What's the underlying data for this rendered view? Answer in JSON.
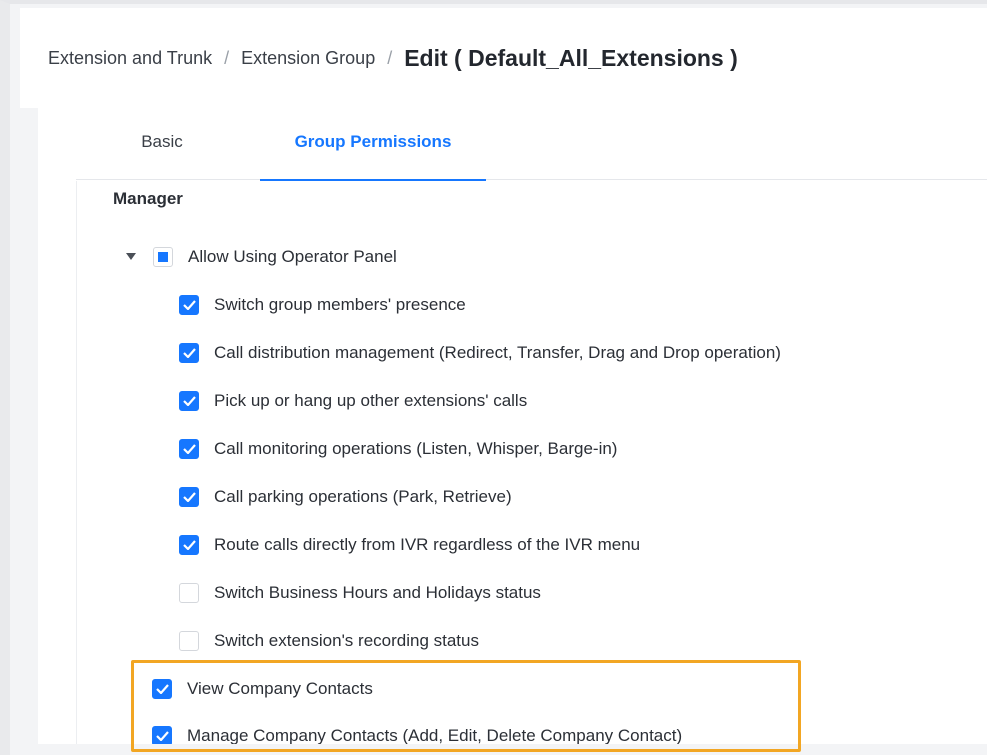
{
  "breadcrumb": {
    "items": [
      "Extension and Trunk",
      "Extension Group"
    ],
    "separator": "/",
    "current": "Edit ( Default_All_Extensions )"
  },
  "tabs": [
    {
      "label": "Basic",
      "active": false
    },
    {
      "label": "Group Permissions",
      "active": true
    }
  ],
  "section": {
    "title": "Manager"
  },
  "operator_panel": {
    "label": "Allow Using Operator Panel",
    "state": "indeterminate",
    "expanded": true,
    "children": [
      {
        "label": "Switch group members' presence",
        "checked": true
      },
      {
        "label": "Call distribution management (Redirect, Transfer, Drag and Drop operation)",
        "checked": true
      },
      {
        "label": "Pick up or hang up other extensions' calls",
        "checked": true
      },
      {
        "label": "Call monitoring operations (Listen, Whisper, Barge-in)",
        "checked": true
      },
      {
        "label": "Call parking operations (Park, Retrieve)",
        "checked": true
      },
      {
        "label": "Route calls directly from IVR regardless of the IVR menu",
        "checked": true
      },
      {
        "label": "Switch Business Hours and Holidays status",
        "checked": false
      },
      {
        "label": "Switch extension's recording status",
        "checked": false
      }
    ]
  },
  "contacts": [
    {
      "label": "View Company Contacts",
      "checked": true
    },
    {
      "label": "Manage Company Contacts (Add, Edit, Delete Company Contact)",
      "checked": true
    }
  ],
  "colors": {
    "accent": "#1677ff",
    "highlight": "#f2a623"
  }
}
